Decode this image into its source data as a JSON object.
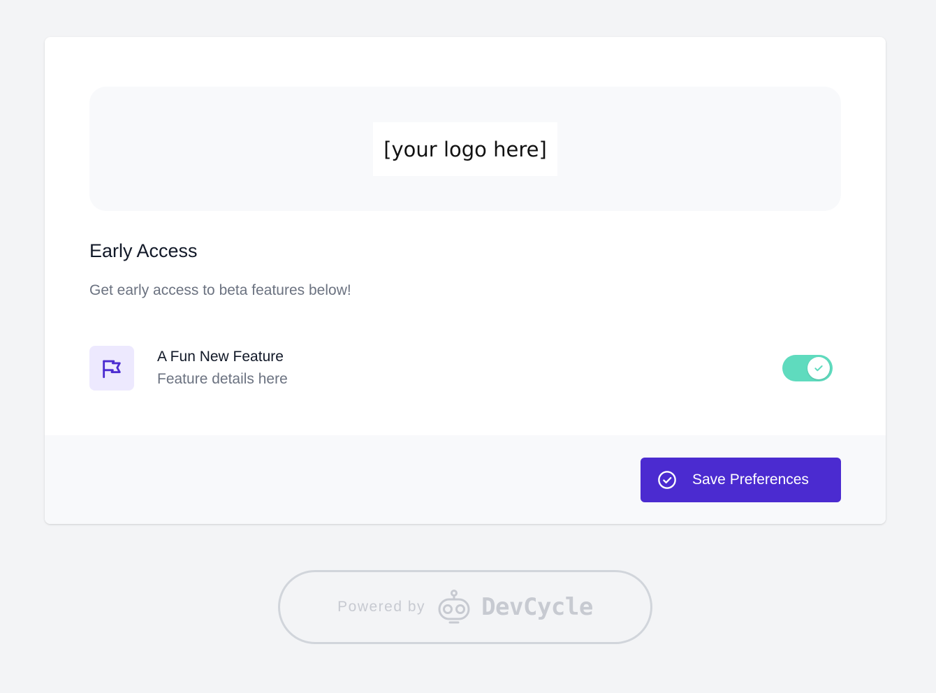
{
  "logo": {
    "placeholder_text": "[your logo here]"
  },
  "section": {
    "title": "Early Access",
    "description": "Get early access to beta features below!"
  },
  "features": [
    {
      "name": "A Fun New Feature",
      "details": "Feature details here",
      "icon": "flag-icon",
      "enabled": true
    }
  ],
  "footer": {
    "save_label": "Save Preferences",
    "save_icon": "check-circle-icon"
  },
  "powered_by": {
    "prefix": "Powered by",
    "brand": "DevCycle",
    "brand_icon": "devcycle-robot-icon"
  },
  "colors": {
    "page_background": "#f3f4f6",
    "accent": "#4b2bd0",
    "toggle_on": "#5fdbbe",
    "icon_background": "#ede9fe"
  }
}
